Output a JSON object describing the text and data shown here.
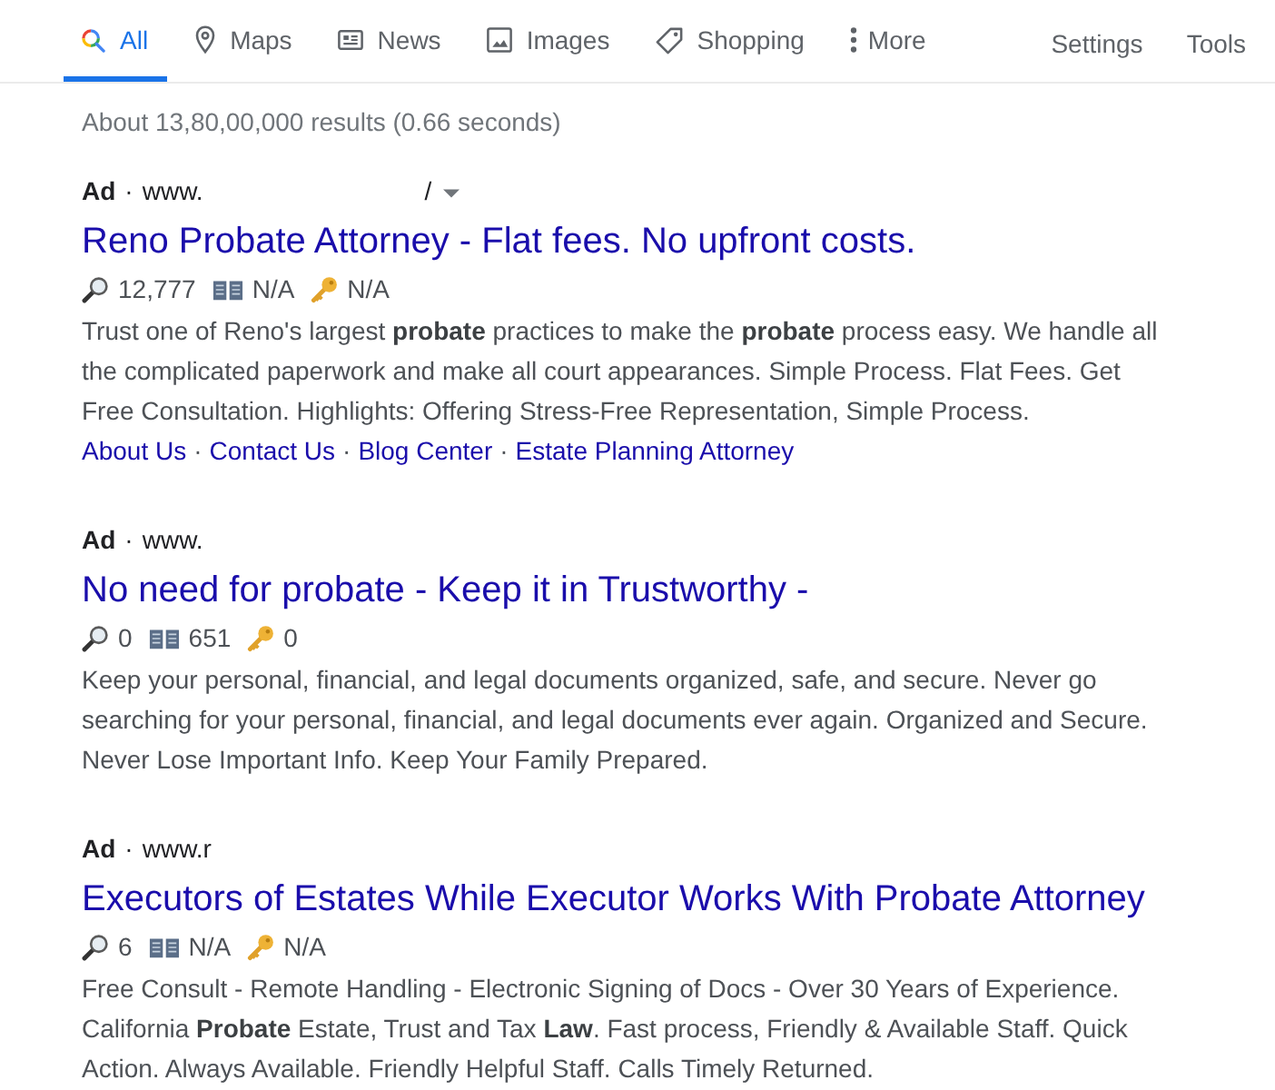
{
  "tabs": [
    {
      "kind": "search",
      "label": "All",
      "selected": true
    },
    {
      "kind": "pin",
      "label": "Maps",
      "selected": false
    },
    {
      "kind": "news",
      "label": "News",
      "selected": false
    },
    {
      "kind": "image",
      "label": "Images",
      "selected": false
    },
    {
      "kind": "tag",
      "label": "Shopping",
      "selected": false
    },
    {
      "kind": "dots",
      "label": "More",
      "selected": false
    }
  ],
  "tools": [
    "Settings",
    "Tools"
  ],
  "result_stats": "About 13,80,00,000 results (0.66 seconds)",
  "ads": [
    {
      "label": "Ad",
      "separator": "·",
      "url": "www.",
      "url_tail": "/",
      "menu": true,
      "title": "Reno Probate Attorney - Flat fees. No upfront costs.",
      "stats": [
        {
          "kind": "searches",
          "value": "12,777"
        },
        {
          "kind": "book",
          "value": "N/A"
        },
        {
          "kind": "key",
          "value": "N/A"
        }
      ],
      "description": "Trust one of Reno's largest **probate** practices to make the **probate** process easy. We handle all the complicated paperwork and make all court appearances. Simple Process. Flat Fees. Get Free Consultation. Highlights: Offering Stress-Free Representation, Simple Process.",
      "sitelinks": [
        "About Us",
        "Contact Us",
        "Blog Center",
        "Estate Planning Attorney"
      ],
      "sitelink_separator": "·"
    },
    {
      "label": "Ad",
      "separator": "·",
      "url": "www.",
      "menu": false,
      "title": "No need for probate - Keep it in Trustworthy -",
      "stats": [
        {
          "kind": "searches",
          "value": "0"
        },
        {
          "kind": "book",
          "value": "651"
        },
        {
          "kind": "key",
          "value": "0"
        }
      ],
      "description": "Keep your personal, financial, and legal documents organized, safe, and secure. Never go searching for your personal, financial, and legal documents ever again. Organized and Secure. Never Lose Important Info. Keep Your Family Prepared."
    },
    {
      "label": "Ad",
      "separator": "·",
      "url": "www.r",
      "menu": false,
      "title": "Executors of Estates While Executor Works With Probate Attorney",
      "stats": [
        {
          "kind": "searches",
          "value": "6"
        },
        {
          "kind": "book",
          "value": "N/A"
        },
        {
          "kind": "key",
          "value": "N/A"
        }
      ],
      "description": "Free Consult - Remote Handling - Electronic Signing of Docs - Over 30 Years of Experience. California **Probate** Estate, Trust and Tax **Law**. Fast process, Friendly & Available Staff. Quick Action. Always Available. Friendly Helpful Staff. Calls Timely Returned."
    }
  ]
}
